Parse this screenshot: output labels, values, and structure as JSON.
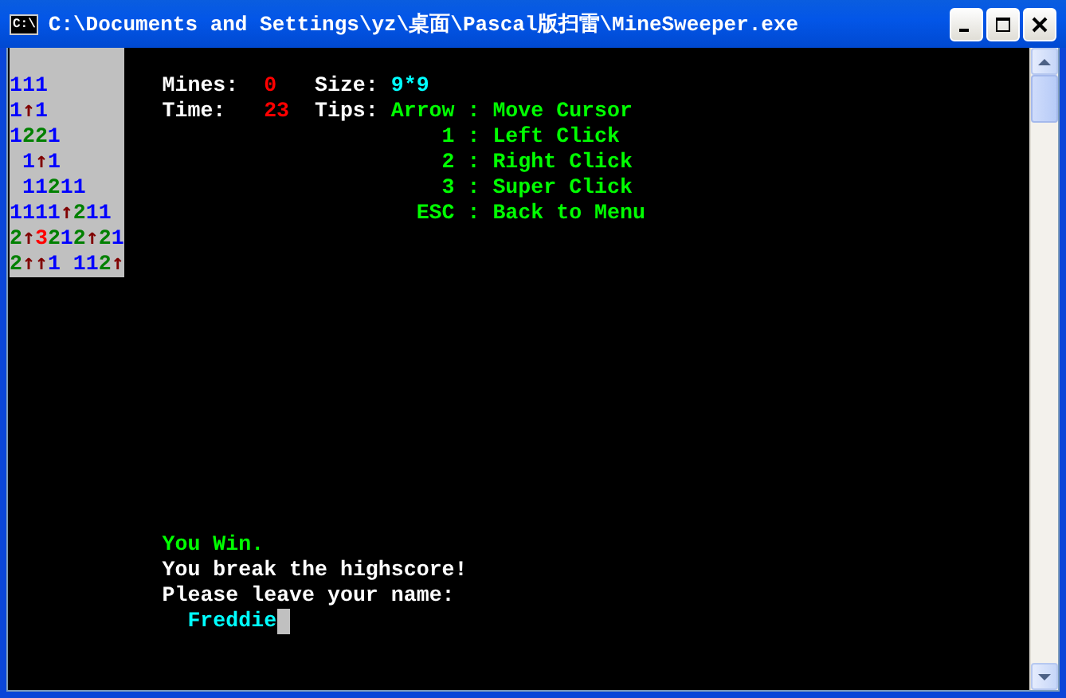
{
  "window": {
    "title": "C:\\Documents and Settings\\yz\\桌面\\Pascal版扫雷\\MineSweeper.exe",
    "icon_text": "C:\\"
  },
  "board": {
    "rows": [
      [
        {
          "kind": "number",
          "text": "1",
          "color": "#0000ff"
        },
        {
          "kind": "number",
          "text": "1",
          "color": "#0000ff"
        },
        {
          "kind": "number",
          "text": "1",
          "color": "#0000ff"
        }
      ],
      [
        {
          "kind": "number",
          "text": "1",
          "color": "#0000ff"
        },
        {
          "kind": "flag",
          "text": "↑",
          "color": "#800000"
        },
        {
          "kind": "number",
          "text": "1",
          "color": "#0000ff"
        }
      ],
      [
        {
          "kind": "number",
          "text": "1",
          "color": "#0000ff"
        },
        {
          "kind": "number",
          "text": "2",
          "color": "#008000"
        },
        {
          "kind": "number",
          "text": "2",
          "color": "#008000"
        },
        {
          "kind": "number",
          "text": "1",
          "color": "#0000ff"
        }
      ],
      [
        {
          "kind": "empty"
        },
        {
          "kind": "number",
          "text": "1",
          "color": "#0000ff"
        },
        {
          "kind": "flag",
          "text": "↑",
          "color": "#800000"
        },
        {
          "kind": "number",
          "text": "1",
          "color": "#0000ff"
        }
      ],
      [
        {
          "kind": "empty"
        },
        {
          "kind": "number",
          "text": "1",
          "color": "#0000ff"
        },
        {
          "kind": "number",
          "text": "1",
          "color": "#0000ff"
        },
        {
          "kind": "number",
          "text": "2",
          "color": "#008000"
        },
        {
          "kind": "number",
          "text": "1",
          "color": "#0000ff"
        },
        {
          "kind": "number",
          "text": "1",
          "color": "#0000ff"
        }
      ],
      [
        {
          "kind": "number",
          "text": "1",
          "color": "#0000ff"
        },
        {
          "kind": "number",
          "text": "1",
          "color": "#0000ff"
        },
        {
          "kind": "number",
          "text": "1",
          "color": "#0000ff"
        },
        {
          "kind": "number",
          "text": "1",
          "color": "#0000ff"
        },
        {
          "kind": "flag",
          "text": "↑",
          "color": "#800000"
        },
        {
          "kind": "number",
          "text": "2",
          "color": "#008000"
        },
        {
          "kind": "number",
          "text": "1",
          "color": "#0000ff"
        },
        {
          "kind": "number",
          "text": "1",
          "color": "#0000ff"
        }
      ],
      [
        {
          "kind": "number",
          "text": "2",
          "color": "#008000"
        },
        {
          "kind": "flag",
          "text": "↑",
          "color": "#800000"
        },
        {
          "kind": "number",
          "text": "3",
          "color": "#ff0000"
        },
        {
          "kind": "number",
          "text": "2",
          "color": "#008000"
        },
        {
          "kind": "number",
          "text": "1",
          "color": "#0000ff"
        },
        {
          "kind": "number",
          "text": "2",
          "color": "#008000"
        },
        {
          "kind": "flag",
          "text": "↑",
          "color": "#800000"
        },
        {
          "kind": "number",
          "text": "2",
          "color": "#008000"
        },
        {
          "kind": "number",
          "text": "1",
          "color": "#0000ff"
        }
      ],
      [
        {
          "kind": "number",
          "text": "2",
          "color": "#008000"
        },
        {
          "kind": "flag",
          "text": "↑",
          "color": "#800000"
        },
        {
          "kind": "flag",
          "text": "↑",
          "color": "#800000"
        },
        {
          "kind": "number",
          "text": "1",
          "color": "#0000ff"
        },
        {
          "kind": "empty"
        },
        {
          "kind": "number",
          "text": "1",
          "color": "#0000ff"
        },
        {
          "kind": "number",
          "text": "1",
          "color": "#0000ff"
        },
        {
          "kind": "number",
          "text": "2",
          "color": "#008000"
        },
        {
          "kind": "flag",
          "text": "↑",
          "color": "#800000"
        }
      ]
    ]
  },
  "status": {
    "mines_label": "Mines:",
    "mines": "0",
    "size_label": "Size:",
    "size": "9*9",
    "time_label": "Time:",
    "time": "23",
    "tips_label": "Tips:"
  },
  "tips": [
    {
      "key": "Arrow",
      "separator": ":",
      "action": "Move Cursor"
    },
    {
      "key": "1",
      "separator": ":",
      "action": "Left Click"
    },
    {
      "key": "2",
      "separator": ":",
      "action": "Right Click"
    },
    {
      "key": "3",
      "separator": ":",
      "action": "Super Click"
    },
    {
      "key": "ESC",
      "separator": ":",
      "action": "Back to Menu"
    }
  ],
  "messages": {
    "result": "You Win.",
    "highscore": "You break the highscore!",
    "prompt": "Please leave your name:",
    "name": "Freddie"
  }
}
